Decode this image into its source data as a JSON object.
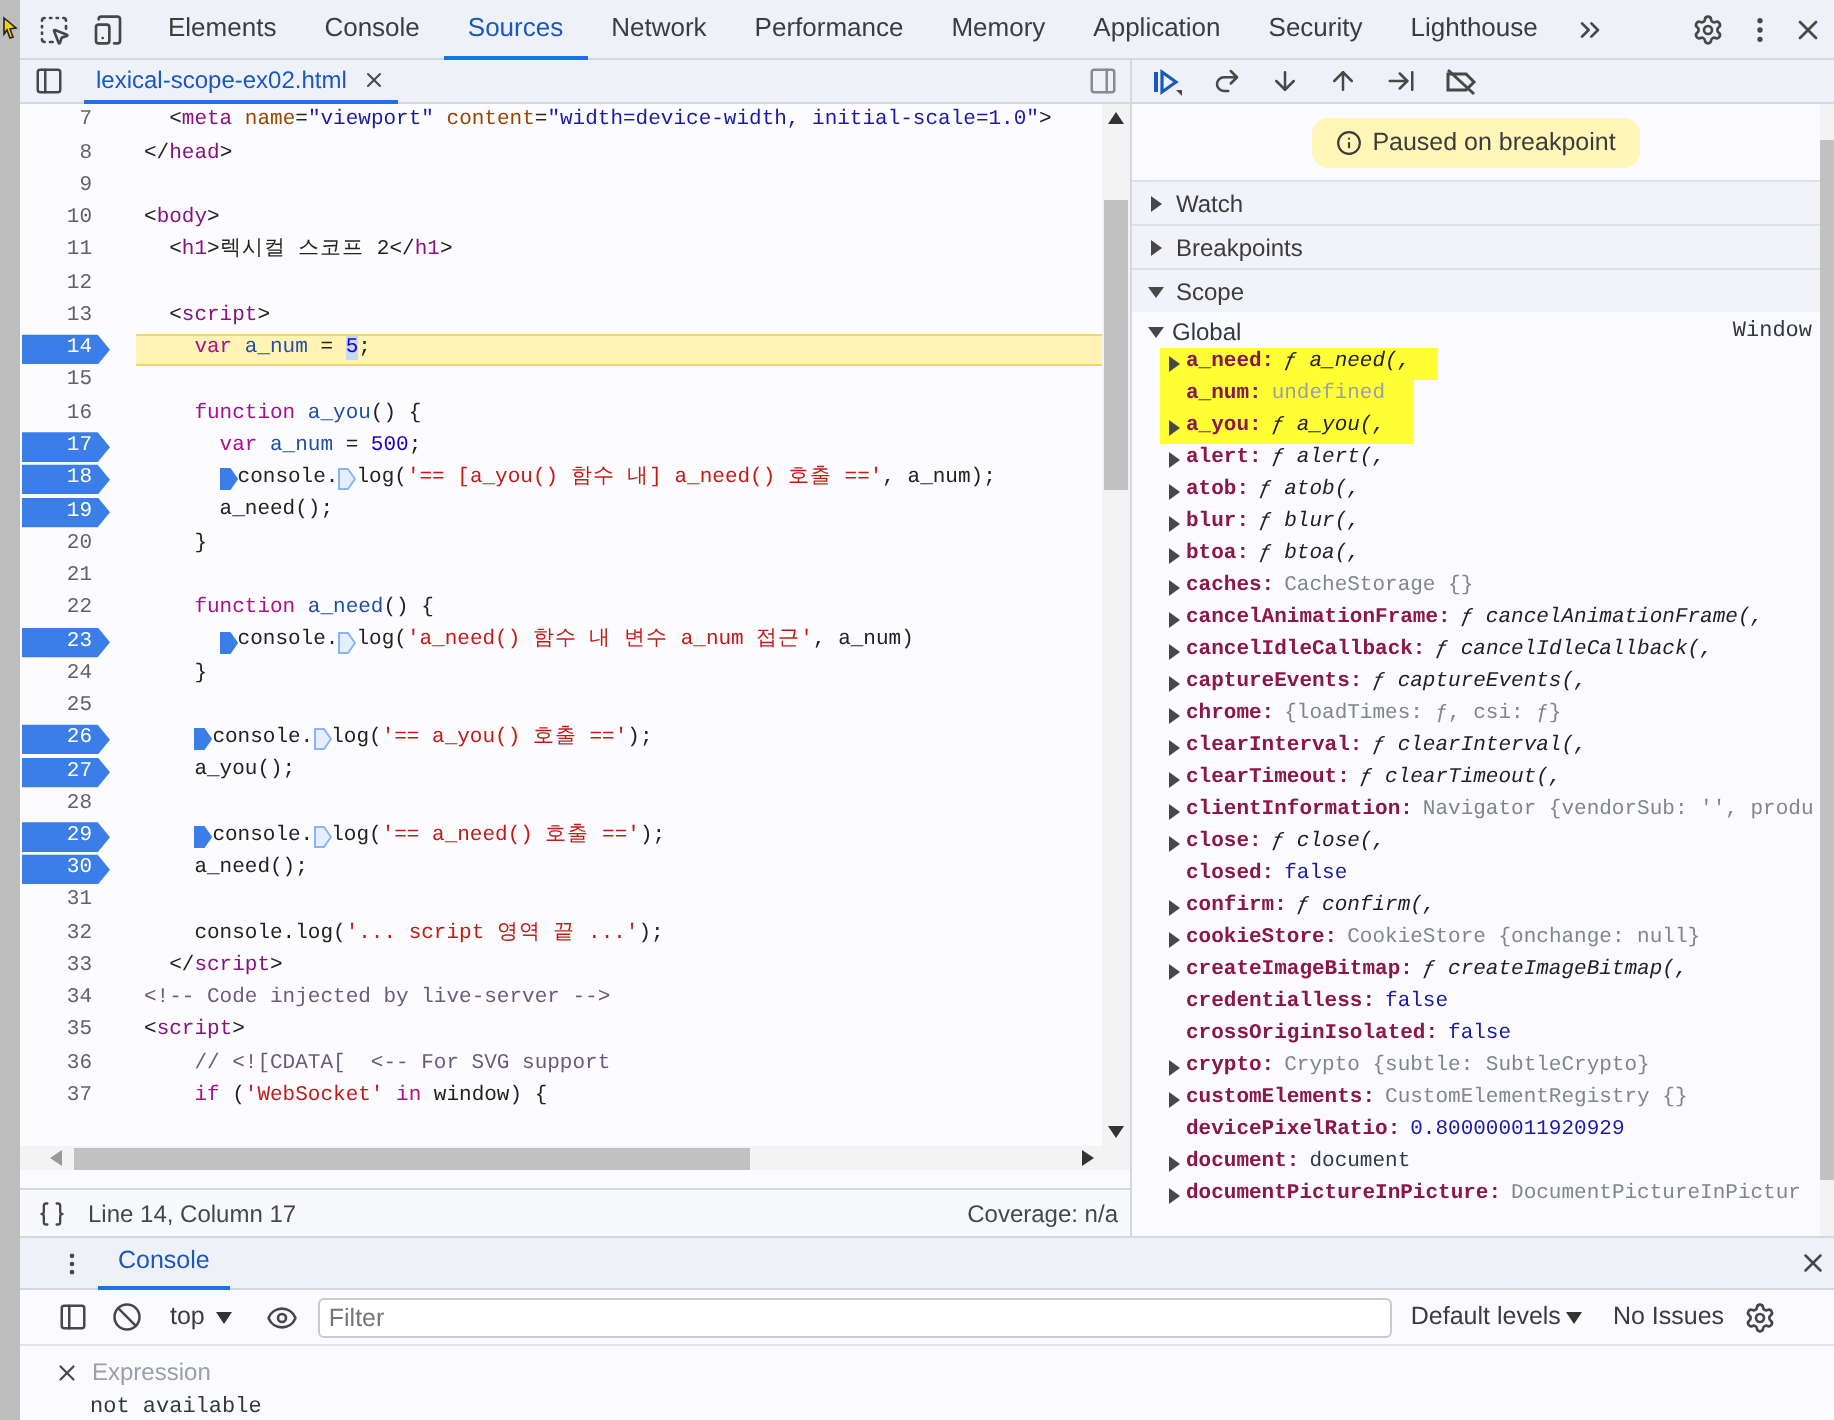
{
  "top_tabs": [
    {
      "label": "Elements",
      "selected": false
    },
    {
      "label": "Console",
      "selected": false
    },
    {
      "label": "Sources",
      "selected": true
    },
    {
      "label": "Network",
      "selected": false
    },
    {
      "label": "Performance",
      "selected": false
    },
    {
      "label": "Memory",
      "selected": false
    },
    {
      "label": "Application",
      "selected": false
    },
    {
      "label": "Security",
      "selected": false
    },
    {
      "label": "Lighthouse",
      "selected": false
    }
  ],
  "file_tab": {
    "label": "lexical-scope-ex02.html"
  },
  "code_lines": [
    {
      "number": "7",
      "breakpoint": false,
      "current": false,
      "tokens": [
        {
          "text": "<",
          "kind": "p"
        },
        {
          "text": "meta",
          "kind": "tag"
        },
        {
          "text": " name",
          "kind": "attr"
        },
        {
          "text": "=",
          "kind": "p"
        },
        {
          "text": "\"viewport\"",
          "kind": "val"
        },
        {
          "text": " content",
          "kind": "attr"
        },
        {
          "text": "=",
          "kind": "p"
        },
        {
          "text": "\"width=device-width, initial-scale=1.0\"",
          "kind": "val"
        },
        {
          "text": ">",
          "kind": "p"
        }
      ]
    },
    {
      "number": "8",
      "breakpoint": false,
      "current": false,
      "tokens": [
        {
          "text": "</",
          "kind": "p"
        },
        {
          "text": "head",
          "kind": "tag"
        },
        {
          "text": ">",
          "kind": "p"
        }
      ]
    },
    {
      "number": "9",
      "breakpoint": false,
      "current": false
    },
    {
      "number": "10",
      "breakpoint": false,
      "current": false,
      "tokens": [
        {
          "text": "<",
          "kind": "p"
        },
        {
          "text": "body",
          "kind": "tag"
        },
        {
          "text": ">",
          "kind": "p"
        }
      ]
    },
    {
      "number": "11",
      "breakpoint": false,
      "current": false,
      "tokens": [
        {
          "text": "<",
          "kind": "p"
        },
        {
          "text": "h1",
          "kind": "tag"
        },
        {
          "text": ">렉시컬 스코프 2</",
          "kind": "p"
        },
        {
          "text": "h1",
          "kind": "tag"
        },
        {
          "text": ">",
          "kind": "p"
        }
      ]
    },
    {
      "number": "12",
      "breakpoint": false,
      "current": false
    },
    {
      "number": "13",
      "breakpoint": false,
      "current": false,
      "tokens": [
        {
          "text": "<",
          "kind": "p"
        },
        {
          "text": "script",
          "kind": "tag"
        },
        {
          "text": ">",
          "kind": "p"
        }
      ]
    },
    {
      "number": "14",
      "breakpoint": true,
      "current": true,
      "tokens": [
        {
          "text": "var",
          "kind": "kw"
        },
        {
          "text": " a_num",
          "kind": "def"
        },
        {
          "text": " = ",
          "kind": "p"
        },
        {
          "text": "5",
          "kind": "sel"
        },
        {
          "text": ";",
          "kind": "p"
        }
      ]
    },
    {
      "number": "15",
      "breakpoint": false,
      "current": false
    },
    {
      "number": "16",
      "breakpoint": false,
      "current": false,
      "tokens": [
        {
          "text": "function",
          "kind": "kw"
        },
        {
          "text": " a_you",
          "kind": "def"
        },
        {
          "text": "() {",
          "kind": "p"
        }
      ]
    },
    {
      "number": "17",
      "breakpoint": true,
      "current": false,
      "tokens": [
        {
          "text": "var",
          "kind": "kw"
        },
        {
          "text": " a_num",
          "kind": "def"
        },
        {
          "text": " = ",
          "kind": "p"
        },
        {
          "text": "500",
          "kind": "num"
        },
        {
          "text": ";",
          "kind": "p"
        }
      ]
    },
    {
      "number": "18",
      "breakpoint": true,
      "current": false,
      "tokens": [
        {
          "kind": "marker",
          "on": true
        },
        {
          "text": "console.",
          "kind": "p"
        },
        {
          "kind": "marker",
          "on": false
        },
        {
          "text": "log(",
          "kind": "p"
        },
        {
          "text": "'== [a_you() 함수 내] a_need() 호출 =='",
          "kind": "str"
        },
        {
          "text": ", a_num);",
          "kind": "p"
        }
      ]
    },
    {
      "number": "19",
      "breakpoint": true,
      "current": false,
      "tokens": [
        {
          "text": "a_need();",
          "kind": "p"
        }
      ]
    },
    {
      "number": "20",
      "breakpoint": false,
      "current": false,
      "tokens": [
        {
          "text": "}",
          "kind": "p"
        }
      ]
    },
    {
      "number": "21",
      "breakpoint": false,
      "current": false
    },
    {
      "number": "22",
      "breakpoint": false,
      "current": false,
      "tokens": [
        {
          "text": "function",
          "kind": "kw"
        },
        {
          "text": " a_need",
          "kind": "def"
        },
        {
          "text": "() {",
          "kind": "p"
        }
      ]
    },
    {
      "number": "23",
      "breakpoint": true,
      "current": false,
      "tokens": [
        {
          "kind": "marker",
          "on": true
        },
        {
          "text": "console.",
          "kind": "p"
        },
        {
          "kind": "marker",
          "on": false
        },
        {
          "text": "log(",
          "kind": "p"
        },
        {
          "text": "'a_need() 함수 내 변수 a_num 접근'",
          "kind": "str"
        },
        {
          "text": ", a_num)",
          "kind": "p"
        }
      ]
    },
    {
      "number": "24",
      "breakpoint": false,
      "current": false,
      "tokens": [
        {
          "text": "}",
          "kind": "p"
        }
      ]
    },
    {
      "number": "25",
      "breakpoint": false,
      "current": false
    },
    {
      "number": "26",
      "breakpoint": true,
      "current": false,
      "tokens": [
        {
          "kind": "marker",
          "on": true
        },
        {
          "text": "console.",
          "kind": "p"
        },
        {
          "kind": "marker",
          "on": false
        },
        {
          "text": "log(",
          "kind": "p"
        },
        {
          "text": "'== a_you() 호출 =='",
          "kind": "str"
        },
        {
          "text": ");",
          "kind": "p"
        }
      ]
    },
    {
      "number": "27",
      "breakpoint": true,
      "current": false,
      "tokens": [
        {
          "text": "a_you();",
          "kind": "p"
        }
      ]
    },
    {
      "number": "28",
      "breakpoint": false,
      "current": false
    },
    {
      "number": "29",
      "breakpoint": true,
      "current": false,
      "tokens": [
        {
          "kind": "marker",
          "on": true
        },
        {
          "text": "console.",
          "kind": "p"
        },
        {
          "kind": "marker",
          "on": false
        },
        {
          "text": "log(",
          "kind": "p"
        },
        {
          "text": "'== a_need() 호출 =='",
          "kind": "str"
        },
        {
          "text": ");",
          "kind": "p"
        }
      ]
    },
    {
      "number": "30",
      "breakpoint": true,
      "current": false,
      "tokens": [
        {
          "text": "a_need();",
          "kind": "p"
        }
      ]
    },
    {
      "number": "31",
      "breakpoint": false,
      "current": false
    },
    {
      "number": "32",
      "breakpoint": false,
      "current": false,
      "tokens": [
        {
          "text": "console.log(",
          "kind": "p"
        },
        {
          "text": "'... script 영역 끝 ...'",
          "kind": "str"
        },
        {
          "text": ");",
          "kind": "p"
        }
      ]
    },
    {
      "number": "33",
      "breakpoint": false,
      "current": false,
      "tokens": [
        {
          "text": "</",
          "kind": "p"
        },
        {
          "text": "script",
          "kind": "tag"
        },
        {
          "text": ">",
          "kind": "p"
        }
      ]
    },
    {
      "number": "34",
      "breakpoint": false,
      "current": false,
      "tokens": [
        {
          "text": "<!-- Code injected by live-server -->",
          "kind": "comment"
        }
      ]
    },
    {
      "number": "35",
      "breakpoint": false,
      "current": false,
      "tokens": [
        {
          "text": "<",
          "kind": "p"
        },
        {
          "text": "script",
          "kind": "tag"
        },
        {
          "text": ">",
          "kind": "p"
        }
      ]
    },
    {
      "number": "36",
      "breakpoint": false,
      "current": false,
      "tokens": [
        {
          "text": "// <![CDATA[  <-- For SVG support",
          "kind": "comment"
        }
      ]
    },
    {
      "number": "37",
      "breakpoint": false,
      "current": false,
      "tokens": [
        {
          "text": "if",
          "kind": "kw"
        },
        {
          "text": " (",
          "kind": "p"
        },
        {
          "text": "'WebSocket'",
          "kind": "str"
        },
        {
          "text": " in",
          "kind": "kw"
        },
        {
          "text": " window) {",
          "kind": "p"
        }
      ]
    }
  ],
  "status_bar": {
    "position": "Line 14, Column 17",
    "coverage": "Coverage: n/a"
  },
  "paused_banner": "Paused on breakpoint",
  "sections": [
    {
      "label": "Watch",
      "expanded": false
    },
    {
      "label": "Breakpoints",
      "expanded": false
    },
    {
      "label": "Scope",
      "expanded": true
    }
  ],
  "scope": {
    "label": "Global",
    "value": "Window",
    "expanded": true,
    "items": [
      {
        "name": "a_need:",
        "value": "ƒ a_need(,",
        "kind": "function",
        "expandable": true,
        "highlighted": true
      },
      {
        "name": "a_num:",
        "value": "undefined",
        "kind": "undefined",
        "expandable": false,
        "highlighted": true
      },
      {
        "name": "a_you:",
        "value": "ƒ a_you(,",
        "kind": "function",
        "expandable": true,
        "highlighted": true
      },
      {
        "name": "alert:",
        "value": "ƒ alert(,",
        "kind": "function",
        "expandable": true,
        "highlighted": false
      },
      {
        "name": "atob:",
        "value": "ƒ atob(,",
        "kind": "function",
        "expandable": true,
        "highlighted": false
      },
      {
        "name": "blur:",
        "value": "ƒ blur(,",
        "kind": "function",
        "expandable": true,
        "highlighted": false
      },
      {
        "name": "btoa:",
        "value": "ƒ btoa(,",
        "kind": "function",
        "expandable": true,
        "highlighted": false
      },
      {
        "name": "caches:",
        "value": "CacheStorage {}",
        "kind": "object",
        "expandable": true,
        "highlighted": false
      },
      {
        "name": "cancelAnimationFrame:",
        "value": "ƒ cancelAnimationFrame(,",
        "kind": "function",
        "expandable": true,
        "highlighted": false
      },
      {
        "name": "cancelIdleCallback:",
        "value": "ƒ cancelIdleCallback(,",
        "kind": "function",
        "expandable": true,
        "highlighted": false
      },
      {
        "name": "captureEvents:",
        "value": "ƒ captureEvents(,",
        "kind": "function",
        "expandable": true,
        "highlighted": false
      },
      {
        "name": "chrome:",
        "value": "{loadTimes: ƒ, csi: ƒ}",
        "kind": "object",
        "expandable": true,
        "highlighted": false
      },
      {
        "name": "clearInterval:",
        "value": "ƒ clearInterval(,",
        "kind": "function",
        "expandable": true,
        "highlighted": false
      },
      {
        "name": "clearTimeout:",
        "value": "ƒ clearTimeout(,",
        "kind": "function",
        "expandable": true,
        "highlighted": false
      },
      {
        "name": "clientInformation:",
        "value": "Navigator {vendorSub: '', produ",
        "kind": "object",
        "expandable": true,
        "highlighted": false
      },
      {
        "name": "close:",
        "value": "ƒ close(,",
        "kind": "function",
        "expandable": true,
        "highlighted": false
      },
      {
        "name": "closed:",
        "value": "false",
        "kind": "boolean",
        "expandable": false,
        "highlighted": false
      },
      {
        "name": "confirm:",
        "value": "ƒ confirm(,",
        "kind": "function",
        "expandable": true,
        "highlighted": false
      },
      {
        "name": "cookieStore:",
        "value": "CookieStore {onchange: null}",
        "kind": "object",
        "expandable": true,
        "highlighted": false
      },
      {
        "name": "createImageBitmap:",
        "value": "ƒ createImageBitmap(,",
        "kind": "function",
        "expandable": true,
        "highlighted": false
      },
      {
        "name": "credentialless:",
        "value": "false",
        "kind": "boolean",
        "expandable": false,
        "highlighted": false
      },
      {
        "name": "crossOriginIsolated:",
        "value": "false",
        "kind": "boolean",
        "expandable": false,
        "highlighted": false
      },
      {
        "name": "crypto:",
        "value": "Crypto {subtle: SubtleCrypto}",
        "kind": "object",
        "expandable": true,
        "highlighted": false
      },
      {
        "name": "customElements:",
        "value": "CustomElementRegistry {}",
        "kind": "object",
        "expandable": true,
        "highlighted": false
      },
      {
        "name": "devicePixelRatio:",
        "value": "0.800000011920929",
        "kind": "number",
        "expandable": false,
        "highlighted": false
      },
      {
        "name": "document:",
        "value": "document",
        "kind": "node",
        "expandable": true,
        "highlighted": false
      },
      {
        "name": "documentPictureInPicture:",
        "value": "DocumentPictureInPictur",
        "kind": "object",
        "expandable": true,
        "highlighted": false
      }
    ]
  },
  "drawer": {
    "tabs": [
      {
        "label": "Console",
        "selected": true
      }
    ],
    "context": "top",
    "filter_placeholder": "Filter",
    "levels": "Default levels",
    "issues": "No Issues",
    "expression_placeholder": "Expression",
    "expression_result": "not available"
  }
}
